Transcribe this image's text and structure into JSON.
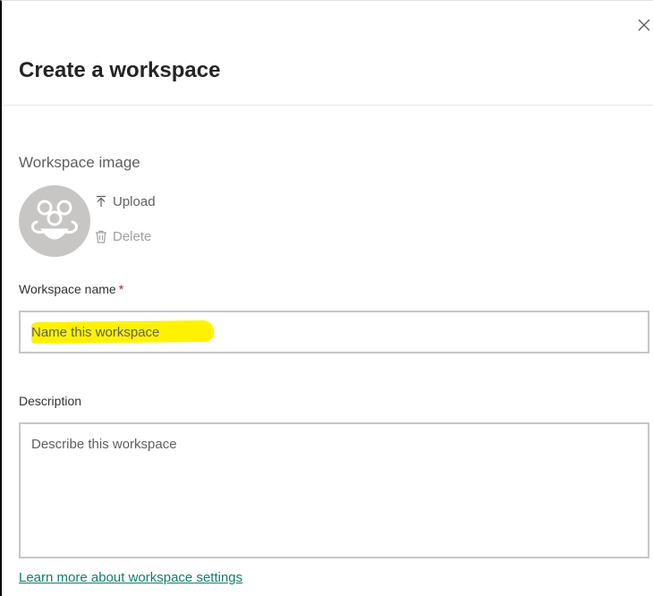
{
  "dialog": {
    "title": "Create a workspace",
    "close_icon": "close-icon"
  },
  "workspace_image": {
    "label": "Workspace image",
    "avatar_icon": "group-avatar-icon",
    "upload_label": "Upload",
    "upload_icon": "upload-icon",
    "delete_label": "Delete",
    "delete_icon": "trash-icon"
  },
  "workspace_name": {
    "label": "Workspace name",
    "required_marker": "*",
    "value": "",
    "placeholder": "Name this workspace",
    "highlight_color": "#fff200"
  },
  "description": {
    "label": "Description",
    "value": "",
    "placeholder": "Describe this workspace"
  },
  "footer": {
    "learn_more_link": "Learn more about workspace settings",
    "link_color": "#107c6d"
  }
}
